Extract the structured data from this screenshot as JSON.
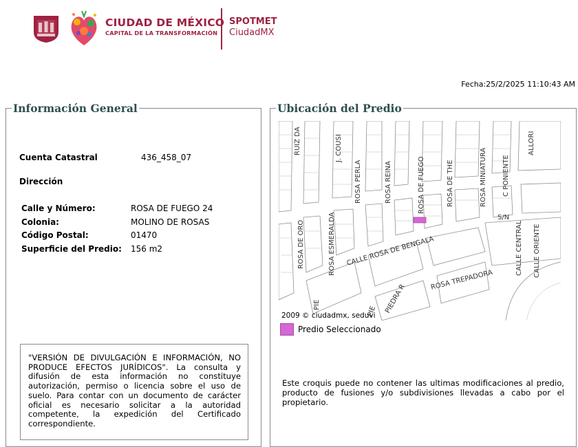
{
  "header": {
    "brand_title": "CIUDAD DE MÉXICO",
    "brand_subtitle": "CAPITAL DE LA TRANSFORMACIÓN",
    "app_name": "SPOTMET",
    "app_sub": "CiudadMX"
  },
  "fecha": "Fecha:25/2/2025 11:10:43 AM",
  "info": {
    "legend": "Información General",
    "cuenta_label": "Cuenta Catastral",
    "cuenta_value": "436_458_07",
    "direccion_label": "Dirección",
    "rows": [
      {
        "label": "Calle y Número:",
        "value": "ROSA DE FUEGO 24"
      },
      {
        "label": "Colonia:",
        "value": "MOLINO DE ROSAS"
      },
      {
        "label": "Código Postal:",
        "value": "01470"
      },
      {
        "label": "Superficie del Predio:",
        "value": "156 m2"
      }
    ],
    "disclaimer": "\"VERSIÓN DE DIVULGACIÓN E INFORMACIÓN, NO PRODUCE EFECTOS JURÍDICOS\". La consulta y difusión de esta información no constituye autorización, permiso o licencia sobre el uso de suelo. Para contar con un documento de carácter oficial es necesario solicitar a la autoridad competente, la expedición del Certificado correspondiente."
  },
  "ubicacion": {
    "legend": "Ubicación del Predio",
    "map_credit": "2009 © ciudadmx, seduvi",
    "streets": [
      "RUIZ DA",
      "J. COUSI",
      "ROSA PERLA",
      "ROSA REINA",
      "ROSA DE FUEGO",
      "ROSA DE THE",
      "ROSA MINIATURA",
      "C PONIENTE",
      "ALLORI",
      "ROSA DE ORO",
      "ROSA ESMERALDA",
      "CALLE ROSA DE BENGALA",
      "S/N",
      "CALLE CENTRAL",
      "CALLE ORIENTE",
      "ROSA TREPADORA",
      "PIE",
      "PIE",
      "PIEDRA R"
    ],
    "legend_label": "Predio Seleccionado",
    "note": "Este croquis puede no contener las ultimas modificaciones al predio, producto de fusiones y/o subdivisiones llevadas a cabo por el propietario.",
    "colors": {
      "selected": "#d667d6",
      "street_line": "#9a9a9a",
      "block": "#ffffff"
    }
  }
}
